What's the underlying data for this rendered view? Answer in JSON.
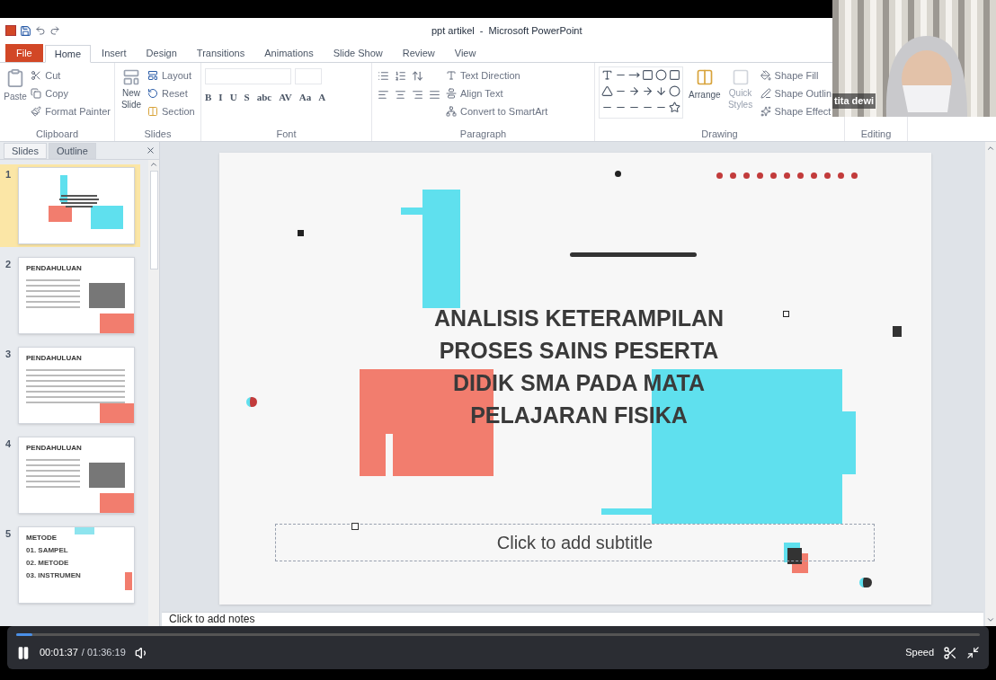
{
  "title_bar": {
    "title": "ppt artikel  -  Microsoft PowerPoint"
  },
  "ribbon_tabs": [
    {
      "label": "File",
      "kind": "file",
      "selected": false
    },
    {
      "label": "Home",
      "kind": "tab",
      "selected": true
    },
    {
      "label": "Insert",
      "kind": "tab",
      "selected": false
    },
    {
      "label": "Design",
      "kind": "tab",
      "selected": false
    },
    {
      "label": "Transitions",
      "kind": "tab",
      "selected": false
    },
    {
      "label": "Animations",
      "kind": "tab",
      "selected": false
    },
    {
      "label": "Slide Show",
      "kind": "tab",
      "selected": false
    },
    {
      "label": "Review",
      "kind": "tab",
      "selected": false
    },
    {
      "label": "View",
      "kind": "tab",
      "selected": false
    }
  ],
  "clipboard": {
    "label": "Clipboard",
    "paste": "Paste",
    "cut": "Cut",
    "copy": "Copy",
    "format_painter": "Format Painter"
  },
  "slides_group": {
    "label": "Slides",
    "new_slide": "New Slide",
    "layout": "Layout",
    "reset": "Reset",
    "section": "Section"
  },
  "font_group": {
    "label": "Font",
    "buttons": [
      "B",
      "I",
      "U",
      "S",
      "abc",
      "AV",
      "Aa",
      "A"
    ]
  },
  "paragraph_group": {
    "label": "Paragraph",
    "text_direction": "Text Direction",
    "align_text": "Align Text",
    "smartart": "Convert to SmartArt"
  },
  "drawing_group": {
    "label": "Drawing",
    "arrange": "Arrange",
    "quick_styles": "Quick Styles",
    "shape_fill": "Shape Fill",
    "shape_outline": "Shape Outlin",
    "shape_effects": "Shape Effect"
  },
  "editing_group": {
    "label": "Editing"
  },
  "webcam": {
    "name": "tita dewi"
  },
  "pane_tabs": [
    {
      "label": "Slides",
      "selected": true
    },
    {
      "label": "Outline",
      "selected": false
    }
  ],
  "thumbnails": [
    {
      "number": "1",
      "kind": "title",
      "selected": true
    },
    {
      "number": "2",
      "kind": "text_image",
      "heading": "PENDAHULUAN",
      "selected": false
    },
    {
      "number": "3",
      "kind": "text",
      "heading": "PENDAHULUAN",
      "selected": false
    },
    {
      "number": "4",
      "kind": "text_image",
      "heading": "PENDAHULUAN",
      "selected": false
    },
    {
      "number": "5",
      "kind": "method",
      "heading": "METODE",
      "items": [
        "01. SAMPEL",
        "02. METODE",
        "03. INSTRUMEN"
      ],
      "selected": false
    }
  ],
  "slide": {
    "title_lines": [
      "ANALISIS KETERAMPILAN",
      "PROSES SAINS PESERTA",
      "DIDIK SMA PADA MATA",
      "PELAJARAN FISIKA"
    ],
    "subtitle_placeholder": "Click to add subtitle"
  },
  "notes": {
    "placeholder": "Click to add notes"
  },
  "player": {
    "playing": true,
    "level": 0.017,
    "elapsed": "00:01:37",
    "duration": "/ 01:36:19",
    "speed": "Speed"
  }
}
